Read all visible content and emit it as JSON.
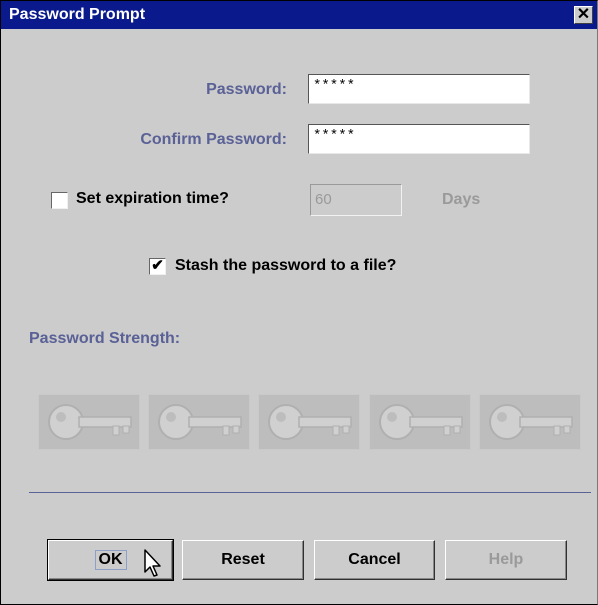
{
  "dialog": {
    "title": "Password Prompt",
    "close_label": "✕"
  },
  "fields": {
    "password_label": "Password:",
    "password_value": "*****",
    "confirm_label": "Confirm Password:",
    "confirm_value": "*****"
  },
  "expiration": {
    "checkbox_label": "Set expiration time?",
    "checked": false,
    "days_value": "60",
    "days_label": "Days"
  },
  "stash": {
    "checkbox_label": "Stash the password to a file?",
    "checked": true,
    "check_glyph": "✔"
  },
  "strength": {
    "label": "Password Strength:",
    "keys": [
      {
        "icon": "key-icon",
        "active": false
      },
      {
        "icon": "key-icon",
        "active": false
      },
      {
        "icon": "key-icon",
        "active": false
      },
      {
        "icon": "key-icon",
        "active": false
      },
      {
        "icon": "key-icon",
        "active": false
      }
    ]
  },
  "buttons": {
    "ok": "OK",
    "reset": "Reset",
    "cancel": "Cancel",
    "help": "Help"
  },
  "colors": {
    "titlebar": "#0a1a8c",
    "label_accent": "#5a6196",
    "disabled_text": "#9a9a9a"
  }
}
